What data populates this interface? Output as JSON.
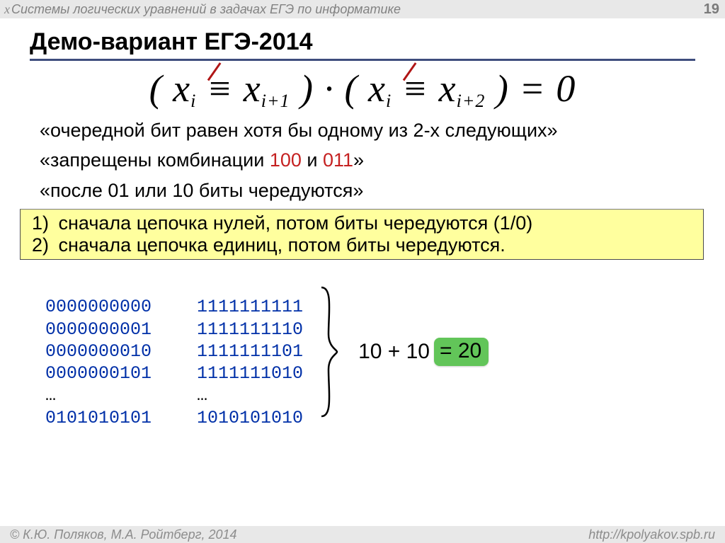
{
  "header": {
    "x": "x",
    "title": "Системы логических уравнений в задачах ЕГЭ по информатике",
    "page": "19"
  },
  "title": "Демо-вариант ЕГЭ-2014",
  "formula": {
    "open1": "(",
    "x1": "x",
    "s1": "i",
    "ne1": "≡",
    "x2": "x",
    "s2": "i+1",
    "close1": ")",
    "dot": "·",
    "open2": "(",
    "x3": "x",
    "s3": "i",
    "ne2": "≡",
    "x4": "x",
    "s4": "i+2",
    "close2": ")",
    "eq": "=",
    "zero": "0"
  },
  "line1_a": "«очередной бит равен хотя бы одному из 2-х следующих»",
  "line2_a": "«запрещены комбинации ",
  "line2_r1": "100",
  "line2_mid": " и ",
  "line2_r2": "011",
  "line2_b": "»",
  "line3": "«после 01 или 10 биты чередуются»",
  "box": {
    "n1": "1)",
    "t1": "сначала цепочка нулей, потом биты чередуются (1/0)",
    "n2": "2)",
    "t2": "сначала цепочка единиц, потом биты чередуются."
  },
  "bits": {
    "col1": [
      "0000000000",
      "0000000001",
      "0000000010",
      "0000000101",
      "…",
      "0101010101"
    ],
    "col2": [
      "1111111111",
      "1111111110",
      "1111111101",
      "1111111010",
      "…",
      "1010101010"
    ]
  },
  "result": {
    "lhs": "10 + 10 ",
    "eq": "= 20"
  },
  "footer": {
    "left": "© К.Ю. Поляков, М.А. Ройтберг, 2014",
    "right": "http://kpolyakov.spb.ru"
  }
}
